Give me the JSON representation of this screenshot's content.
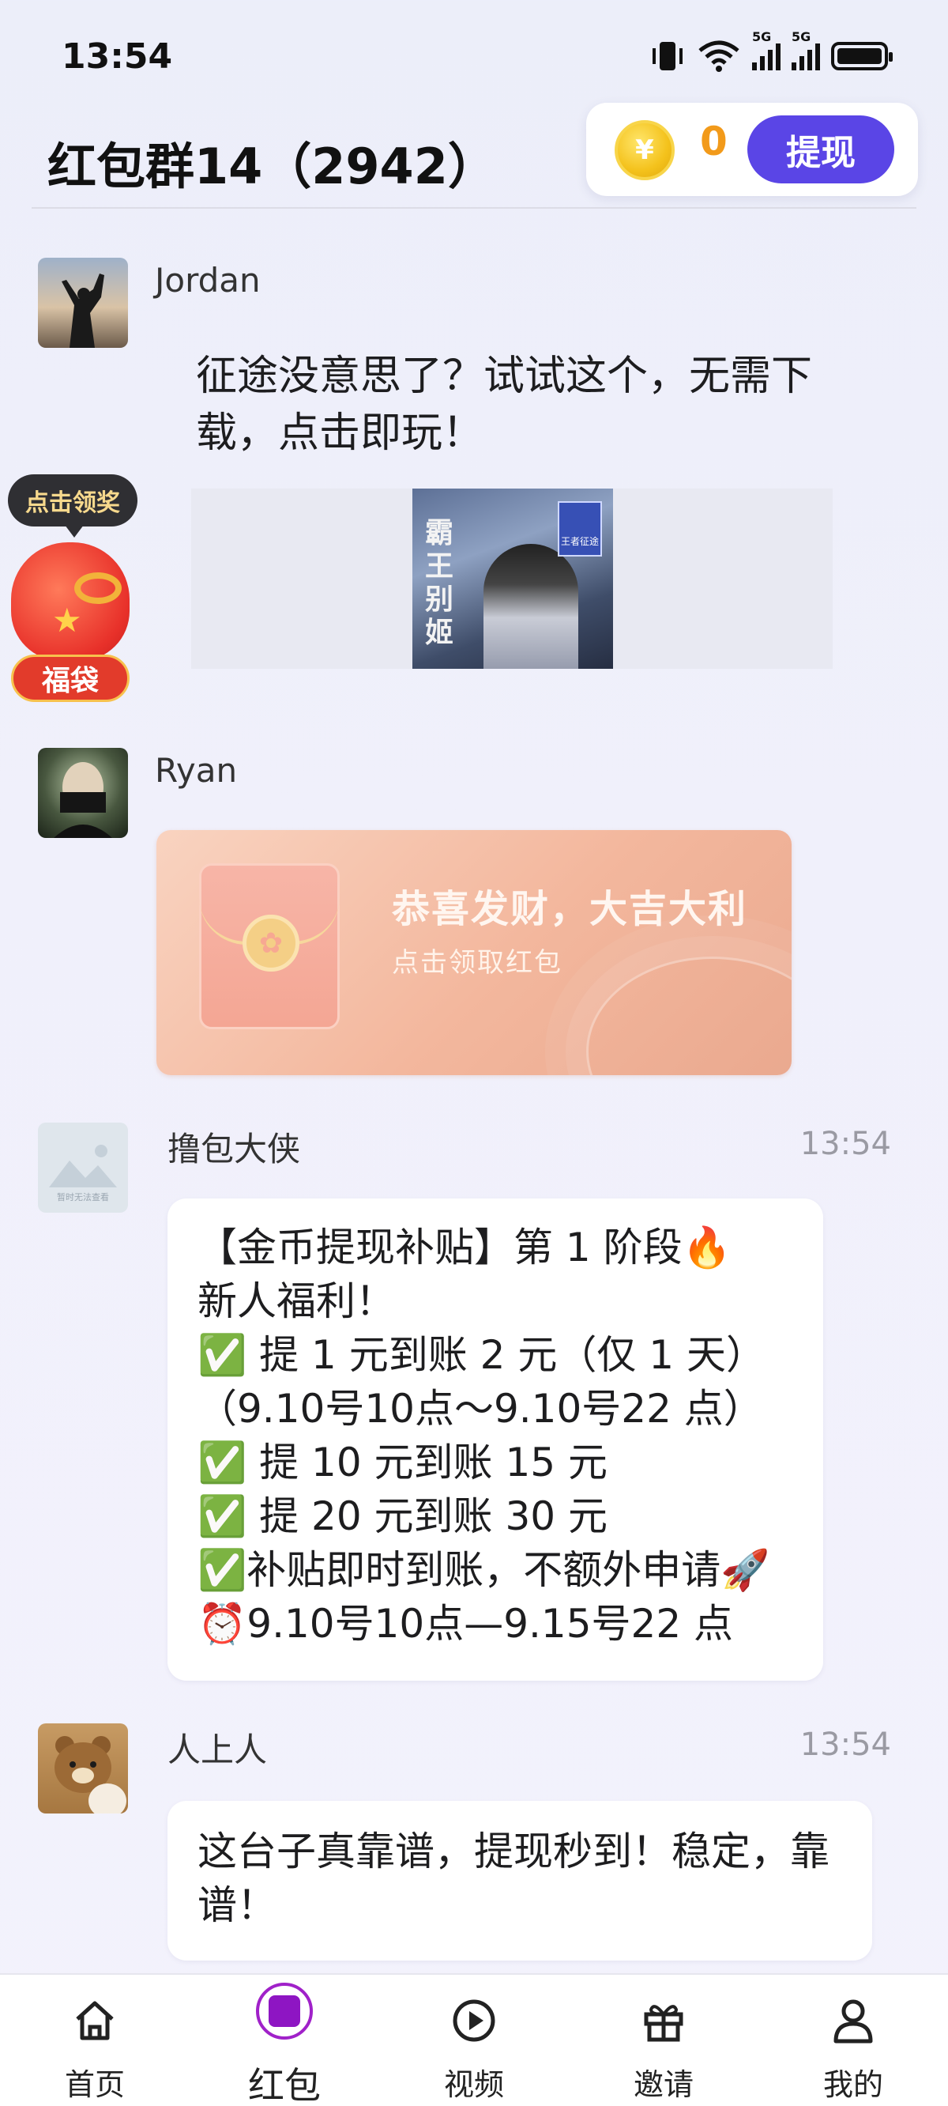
{
  "status_bar": {
    "time": "13:54",
    "signal_1_label": "5G",
    "signal_2_label": "5G"
  },
  "header": {
    "title": "红包群14（2942）"
  },
  "wallet": {
    "coin_symbol": "¥",
    "coin_count": "0",
    "withdraw_label": "提现"
  },
  "lucky_bag": {
    "tip": "点击领奖",
    "label": "福袋"
  },
  "messages": [
    {
      "sender": "Jordan",
      "text": "征途没意思了？试试这个，无需下载，点击即玩！",
      "image_title": "霸王别姬",
      "image_badge": "王者征途"
    },
    {
      "sender": "Ryan",
      "redpacket_title": "恭喜发财，大吉大利",
      "redpacket_sub": "点击领取红包"
    },
    {
      "sender": "撸包大侠",
      "time": "13:54",
      "avatar_text": "暂时无法查看",
      "lines": [
        "【金币提现补贴】第 1 阶段🔥",
        "新人福利！",
        "✅ 提 1 元到账 2 元（仅 1 天）",
        "（9.10号10点～9.10号22 点）",
        "✅ 提 10 元到账 15 元",
        "✅ 提 20 元到账 30 元",
        "✅补贴即时到账，不额外申请🚀",
        "⏰9.10号10点—9.15号22 点"
      ]
    },
    {
      "sender": "人上人",
      "time": "13:54",
      "text": "这台子真靠谱，提现秒到！稳定，靠谱！"
    }
  ],
  "nav": [
    {
      "label": "首页",
      "icon": "home-icon"
    },
    {
      "label": "红包",
      "icon": "red-packet-icon",
      "active": true
    },
    {
      "label": "视频",
      "icon": "play-icon"
    },
    {
      "label": "邀请",
      "icon": "gift-icon"
    },
    {
      "label": "我的",
      "icon": "user-icon"
    }
  ],
  "colors": {
    "accent": "#5a45e6",
    "coin": "#f29a1a",
    "nav_active": "#a021c9"
  }
}
